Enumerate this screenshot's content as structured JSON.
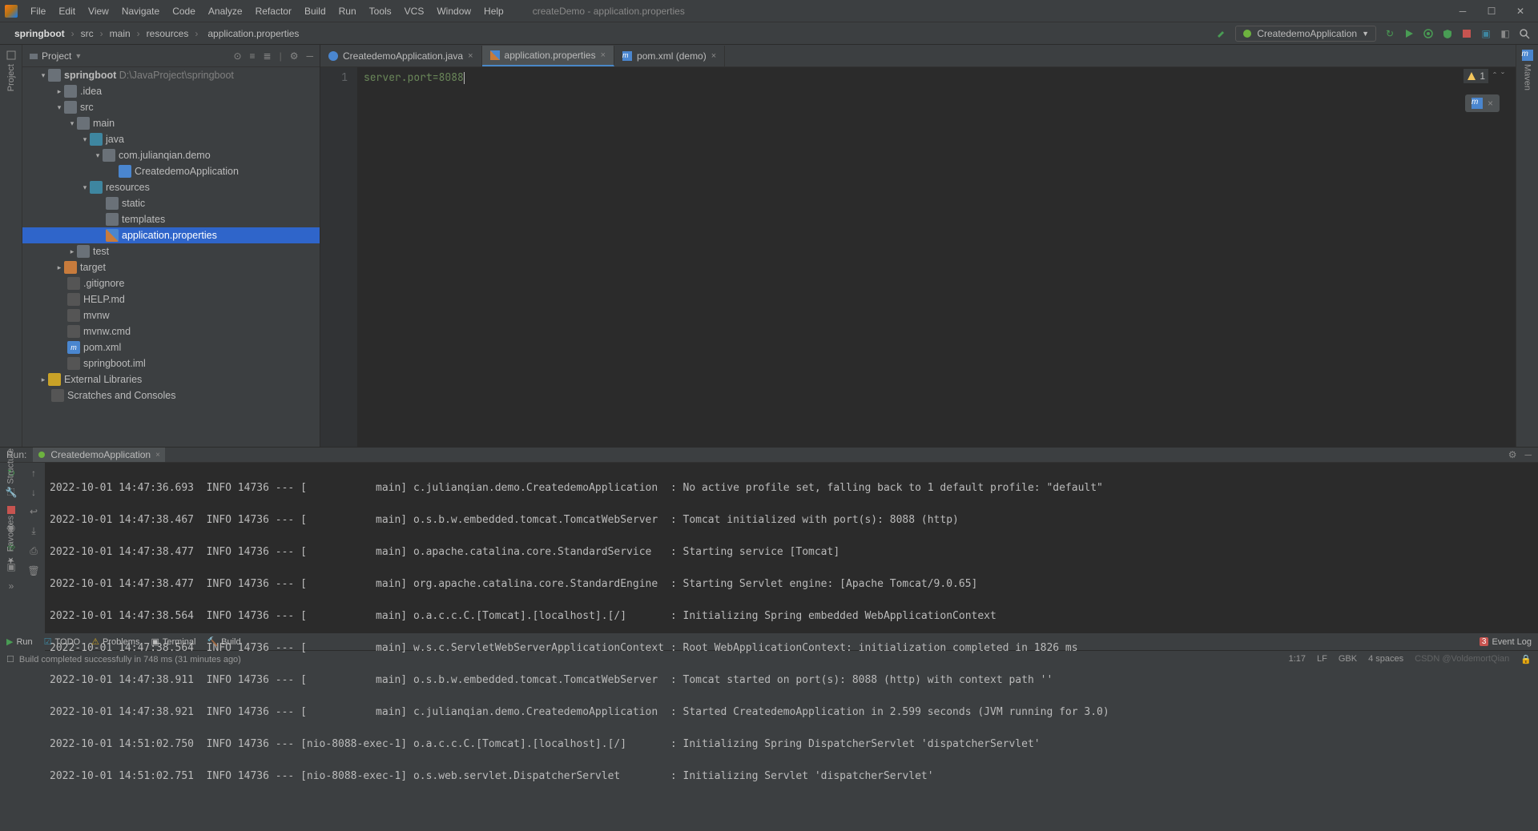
{
  "window": {
    "title": "createDemo - application.properties",
    "menu": [
      "File",
      "Edit",
      "View",
      "Navigate",
      "Code",
      "Analyze",
      "Refactor",
      "Build",
      "Run",
      "Tools",
      "VCS",
      "Window",
      "Help"
    ]
  },
  "breadcrumbs": [
    "springboot",
    "src",
    "main",
    "resources",
    "application.properties"
  ],
  "runConfig": "CreatedemoApplication",
  "toolbarIcons": [
    "hammer",
    "reload",
    "run",
    "debug",
    "coverage",
    "stop",
    "open-folder",
    "search"
  ],
  "projectPane": {
    "title": "Project"
  },
  "tree": {
    "root": {
      "name": "springboot",
      "path": "D:\\JavaProject\\springboot"
    },
    "idea": ".idea",
    "src": "src",
    "main": "main",
    "java": "java",
    "pkg": "com.julianqian.demo",
    "appClass": "CreatedemoApplication",
    "resources": "resources",
    "static": "static",
    "templates": "templates",
    "appProps": "application.properties",
    "test": "test",
    "target": "target",
    "gitignore": ".gitignore",
    "help": "HELP.md",
    "mvnw": "mvnw",
    "mvnwcmd": "mvnw.cmd",
    "pom": "pom.xml",
    "iml": "springboot.iml",
    "extLibs": "External Libraries",
    "scratches": "Scratches and Consoles"
  },
  "tabs": [
    {
      "label": "CreatedemoApplication.java",
      "icon": "java",
      "active": false
    },
    {
      "label": "application.properties",
      "icon": "prop",
      "active": true
    },
    {
      "label": "pom.xml (demo)",
      "icon": "maven",
      "active": false
    }
  ],
  "editor": {
    "lineNo": "1",
    "content": "server.port=8088",
    "warnCount": "1"
  },
  "run": {
    "label": "Run:",
    "config": "CreatedemoApplication"
  },
  "console": [
    "2022-10-01 14:47:36.693  INFO 14736 --- [           main] c.julianqian.demo.CreatedemoApplication  : No active profile set, falling back to 1 default profile: \"default\"",
    "2022-10-01 14:47:38.467  INFO 14736 --- [           main] o.s.b.w.embedded.tomcat.TomcatWebServer  : Tomcat initialized with port(s): 8088 (http)",
    "2022-10-01 14:47:38.477  INFO 14736 --- [           main] o.apache.catalina.core.StandardService   : Starting service [Tomcat]",
    "2022-10-01 14:47:38.477  INFO 14736 --- [           main] org.apache.catalina.core.StandardEngine  : Starting Servlet engine: [Apache Tomcat/9.0.65]",
    "2022-10-01 14:47:38.564  INFO 14736 --- [           main] o.a.c.c.C.[Tomcat].[localhost].[/]       : Initializing Spring embedded WebApplicationContext",
    "2022-10-01 14:47:38.564  INFO 14736 --- [           main] w.s.c.ServletWebServerApplicationContext : Root WebApplicationContext: initialization completed in 1826 ms",
    "2022-10-01 14:47:38.911  INFO 14736 --- [           main] o.s.b.w.embedded.tomcat.TomcatWebServer  : Tomcat started on port(s): 8088 (http) with context path ''",
    "2022-10-01 14:47:38.921  INFO 14736 --- [           main] c.julianqian.demo.CreatedemoApplication  : Started CreatedemoApplication in 2.599 seconds (JVM running for 3.0)",
    "2022-10-01 14:51:02.750  INFO 14736 --- [nio-8088-exec-1] o.a.c.c.C.[Tomcat].[localhost].[/]       : Initializing Spring DispatcherServlet 'dispatcherServlet'",
    "2022-10-01 14:51:02.751  INFO 14736 --- [nio-8088-exec-1] o.s.web.servlet.DispatcherServlet        : Initializing Servlet 'dispatcherServlet'"
  ],
  "bottomTabs": {
    "run": "Run",
    "todo": "TODO",
    "problems": "Problems",
    "terminal": "Terminal",
    "build": "Build",
    "eventLog": "Event Log",
    "eventCount": "3"
  },
  "status": {
    "msg": "Build completed successfully in 748 ms (31 minutes ago)",
    "pos": "1:17",
    "le": "LF",
    "enc": "GBK",
    "spaces": "4 spaces",
    "watermark": "CSDN @VoldemortQian"
  },
  "leftStrip": {
    "structure": "Structure",
    "favorites": "Favorites"
  },
  "rightStrip": {
    "maven": "Maven"
  }
}
